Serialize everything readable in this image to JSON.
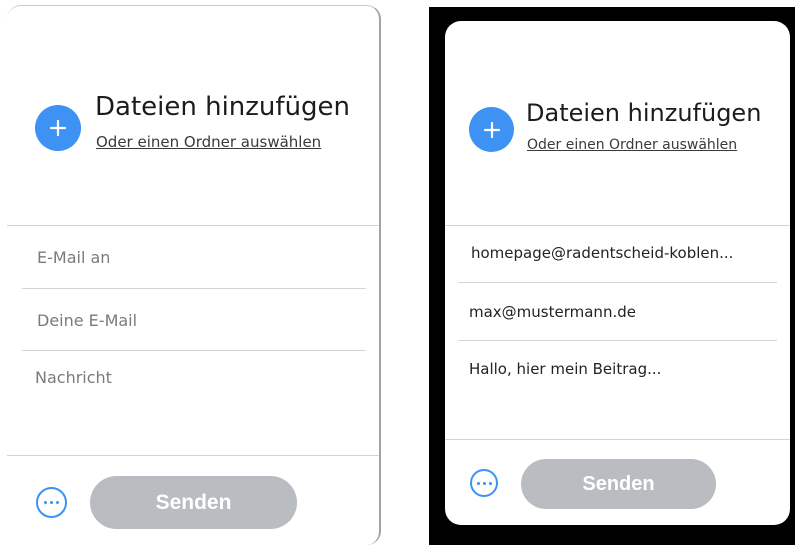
{
  "left_form": {
    "title": "Dateien hinzufügen",
    "folder_link": "Oder einen Ordner auswählen",
    "to_email_placeholder": "E-Mail an",
    "from_email_placeholder": "Deine E-Mail",
    "message_placeholder": "Nachricht",
    "send_label": "Senden"
  },
  "right_form": {
    "title": "Dateien hinzufügen",
    "folder_link": "Oder einen Ordner auswählen",
    "to_email_value": "homepage@radentscheid-koblen...",
    "from_email_value": "max@mustermann.de",
    "message_value": "Hallo, hier mein Beitrag...",
    "send_label": "Senden"
  },
  "colors": {
    "accent": "#3d92f4",
    "send_button_disabled": "#b9bcc1",
    "divider": "#d4d4d4"
  },
  "icons": {
    "add": "plus-icon",
    "more": "ellipsis-icon"
  }
}
